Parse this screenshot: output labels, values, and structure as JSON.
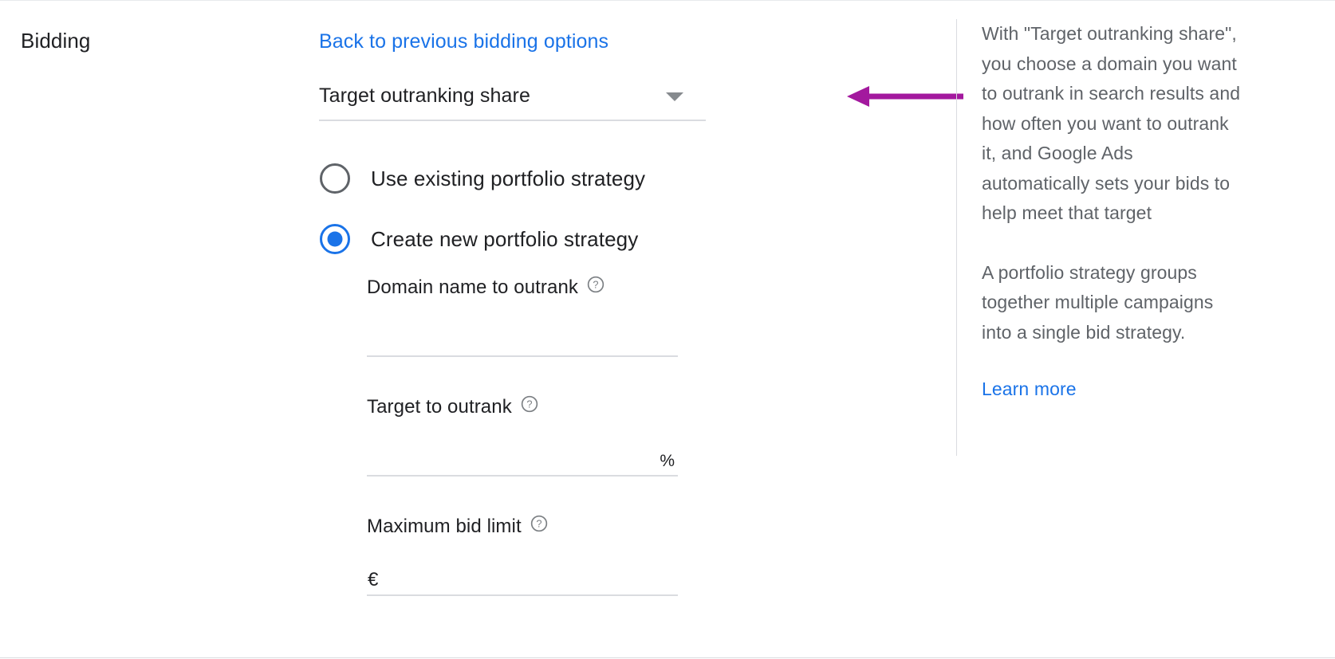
{
  "left": {
    "section_label": "Bidding"
  },
  "center": {
    "back_link": "Back to previous bidding options",
    "strategy_select": {
      "value": "Target outranking share",
      "icon": "chevron-down-icon"
    },
    "annotation": {
      "type": "arrow",
      "direction": "left",
      "color": "#a3199e"
    },
    "portfolio_options": [
      {
        "label": "Use existing portfolio strategy",
        "selected": false
      },
      {
        "label": "Create new portfolio strategy",
        "selected": true
      }
    ],
    "fields": [
      {
        "label": "Domain name to outrank",
        "help_icon": "help-circle-icon",
        "value": "",
        "placeholder": "",
        "prefix": "",
        "suffix": ""
      },
      {
        "label": "Target to outrank",
        "help_icon": "help-circle-icon",
        "value": "",
        "placeholder": "",
        "prefix": "",
        "suffix": "%"
      },
      {
        "label": "Maximum bid limit",
        "help_icon": "help-circle-icon",
        "value": "",
        "placeholder": "",
        "prefix": "€",
        "suffix": ""
      }
    ]
  },
  "info": {
    "paragraph_1": "With \"Target outranking share\", you choose a domain you want to outrank in search results and how often you want to outrank it, and Google Ads automatically sets your bids to help meet that target",
    "paragraph_2": "A portfolio strategy groups together multiple campaigns into a single bid strategy.",
    "learn_more": "Learn more"
  },
  "colors": {
    "link": "#1a73e8",
    "accent_radio": "#1a73e8",
    "annotation": "#a3199e",
    "text_primary": "#202124",
    "text_secondary": "#5f6368",
    "divider": "#dadce0"
  }
}
